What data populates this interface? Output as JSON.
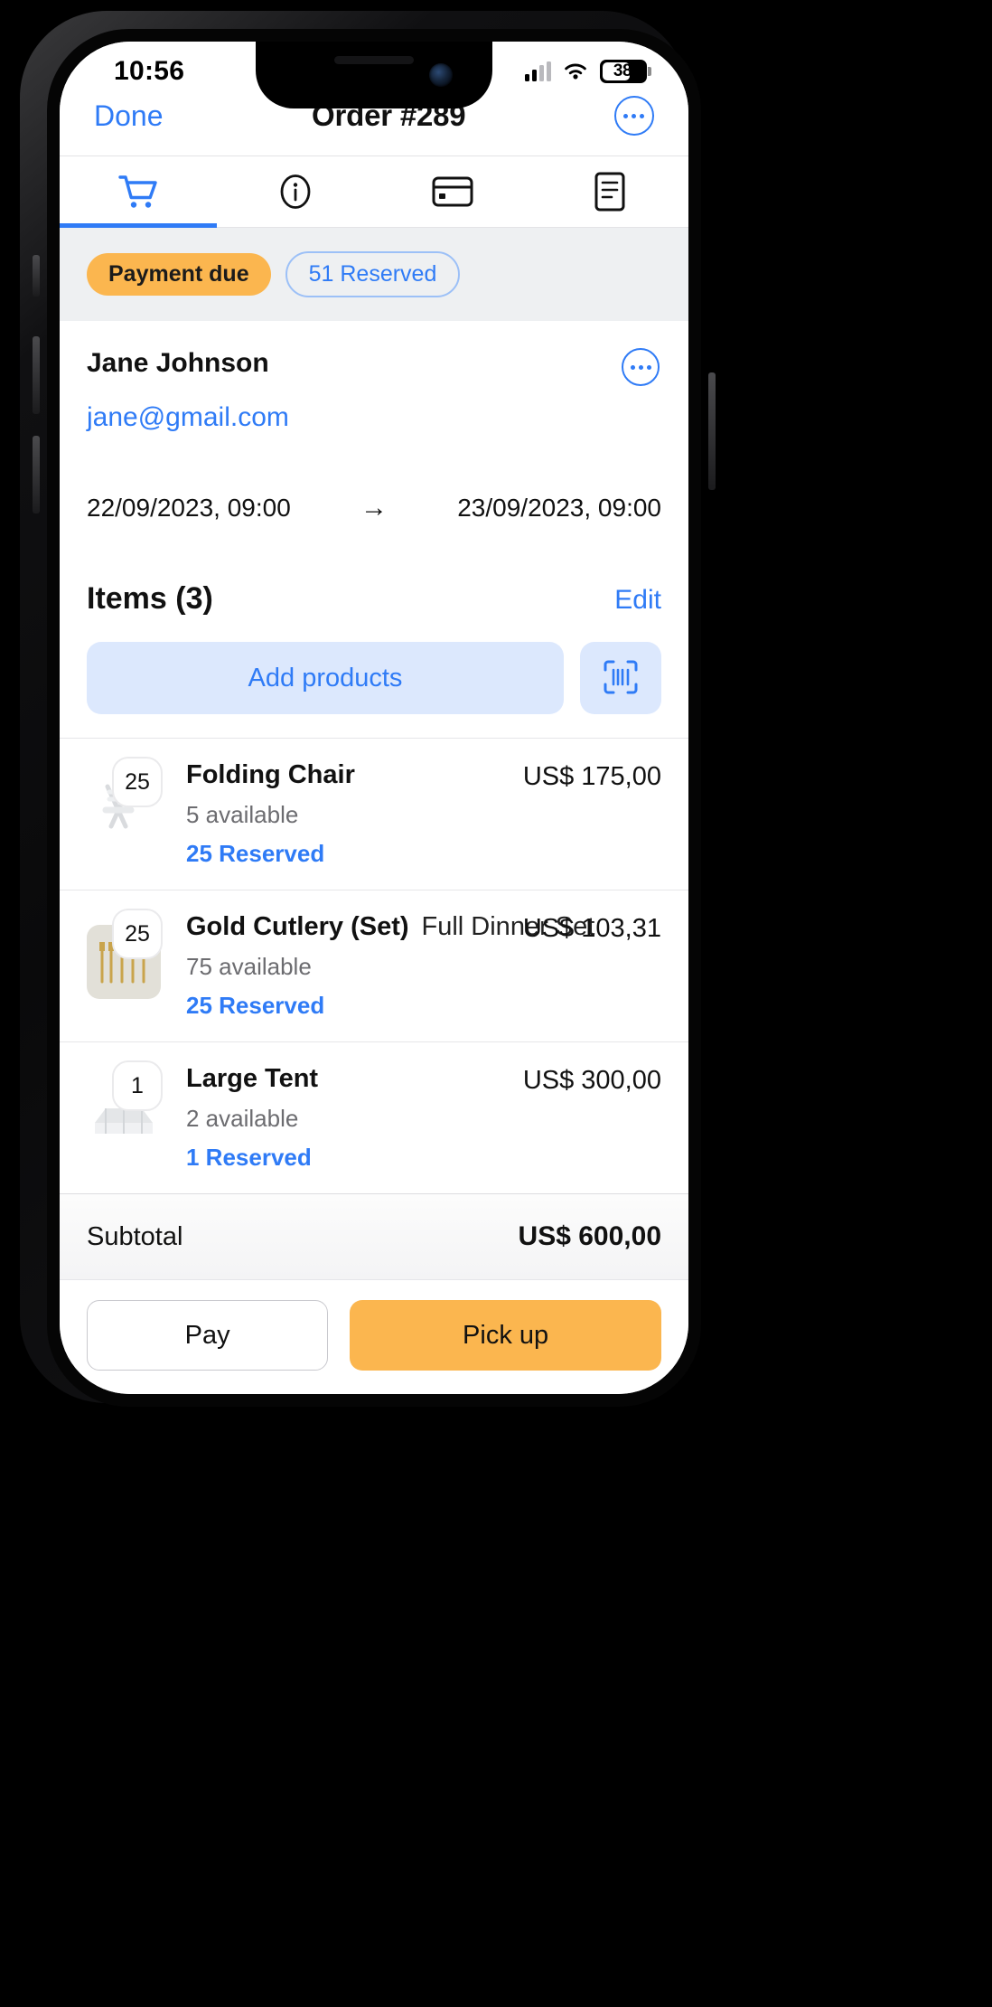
{
  "status_bar": {
    "time": "10:56",
    "battery_percent": "38",
    "icons": [
      "cellular-signal-icon",
      "wifi-icon",
      "battery-icon"
    ]
  },
  "nav": {
    "done_label": "Done",
    "title": "Order #289",
    "more_icon": "ellipsis-circle-icon"
  },
  "tabs": [
    {
      "icon": "shopping-cart-icon",
      "active": true
    },
    {
      "icon": "info-circle-icon",
      "active": false
    },
    {
      "icon": "credit-card-icon",
      "active": false
    },
    {
      "icon": "document-icon",
      "active": false
    }
  ],
  "badges": {
    "status_label": "Payment due",
    "reserved_label": "51 Reserved",
    "status_color": "#FBB64F",
    "reserved_color": "#2F7BF6"
  },
  "customer": {
    "name": "Jane Johnson",
    "email": "jane@gmail.com",
    "more_icon": "ellipsis-circle-icon"
  },
  "date_range": {
    "start": "22/09/2023, 09:00",
    "arrow": "→",
    "end": "23/09/2023, 09:00"
  },
  "items_section": {
    "title": "Items  (3)",
    "edit_label": "Edit",
    "add_products_label": "Add products",
    "scan_icon": "barcode-scan-icon"
  },
  "items": [
    {
      "qty": "25",
      "name": "Folding Chair",
      "variant": "",
      "available": "5 available",
      "reserved": "25 Reserved",
      "price": "US$ 175,00",
      "thumb": "folding-chair-image"
    },
    {
      "qty": "25",
      "name": "Gold Cutlery (Set)",
      "variant": "Full Dinner Set",
      "available": "75 available",
      "reserved": "25 Reserved",
      "price": "US$ 103,31",
      "thumb": "gold-cutlery-image"
    },
    {
      "qty": "1",
      "name": "Large Tent",
      "variant": "",
      "available": "2 available",
      "reserved": "1 Reserved",
      "price": "US$ 300,00",
      "thumb": "large-tent-image"
    }
  ],
  "subtotal": {
    "label": "Subtotal",
    "value": "US$ 600,00"
  },
  "actions": {
    "pay_label": "Pay",
    "pickup_label": "Pick up",
    "pickup_color": "#FBB64F"
  }
}
